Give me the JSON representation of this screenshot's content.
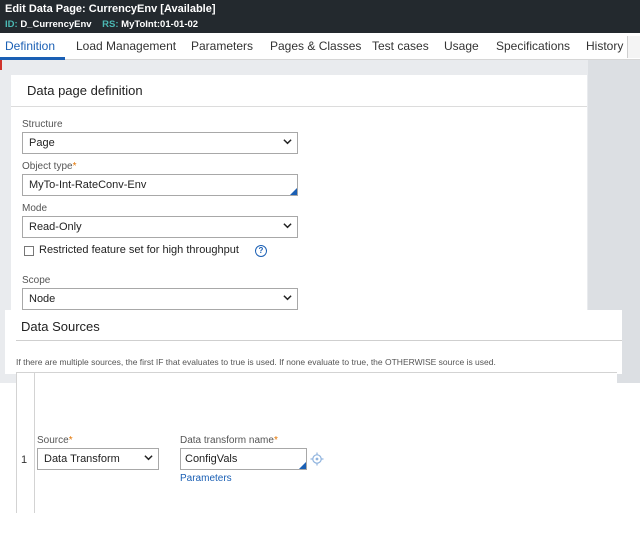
{
  "header": {
    "edit_word": "Edit",
    "title": "Data Page: CurrencyEnv [Available]",
    "id_key": "ID:",
    "id_value": "D_CurrencyEnv",
    "rs_key": "RS:",
    "rs_value": "MyToInt:01-01-02"
  },
  "tabs": [
    "Definition",
    "Load Management",
    "Parameters",
    "Pages & Classes",
    "Test cases",
    "Usage",
    "Specifications",
    "History"
  ],
  "active_tab": "Definition",
  "definition": {
    "heading": "Data page definition",
    "structure_label": "Structure",
    "structure_value": "Page",
    "object_type_label": "Object type",
    "object_type_value": "MyTo-Int-RateConv-Env",
    "mode_label": "Mode",
    "mode_value": "Read-Only",
    "restricted_label": "Restricted feature set for high throughput",
    "restricted_checked": false,
    "help_glyph": "?",
    "scope_label": "Scope",
    "scope_value": "Node"
  },
  "data_sources": {
    "heading": "Data Sources",
    "note": "If there are multiple sources, the first IF that evaluates to true is used. If none evaluate to true, the OTHERWISE source is used.",
    "row_number": "1",
    "source_label": "Source",
    "source_value": "Data Transform",
    "dt_name_label": "Data transform name",
    "dt_name_value": "ConfigVals",
    "parameters_link": "Parameters"
  },
  "required_mark": "*",
  "colors": {
    "accent": "#1a5fb4",
    "required": "#e37400",
    "header_bg": "#23292e",
    "id_label": "#4bb8b3"
  }
}
